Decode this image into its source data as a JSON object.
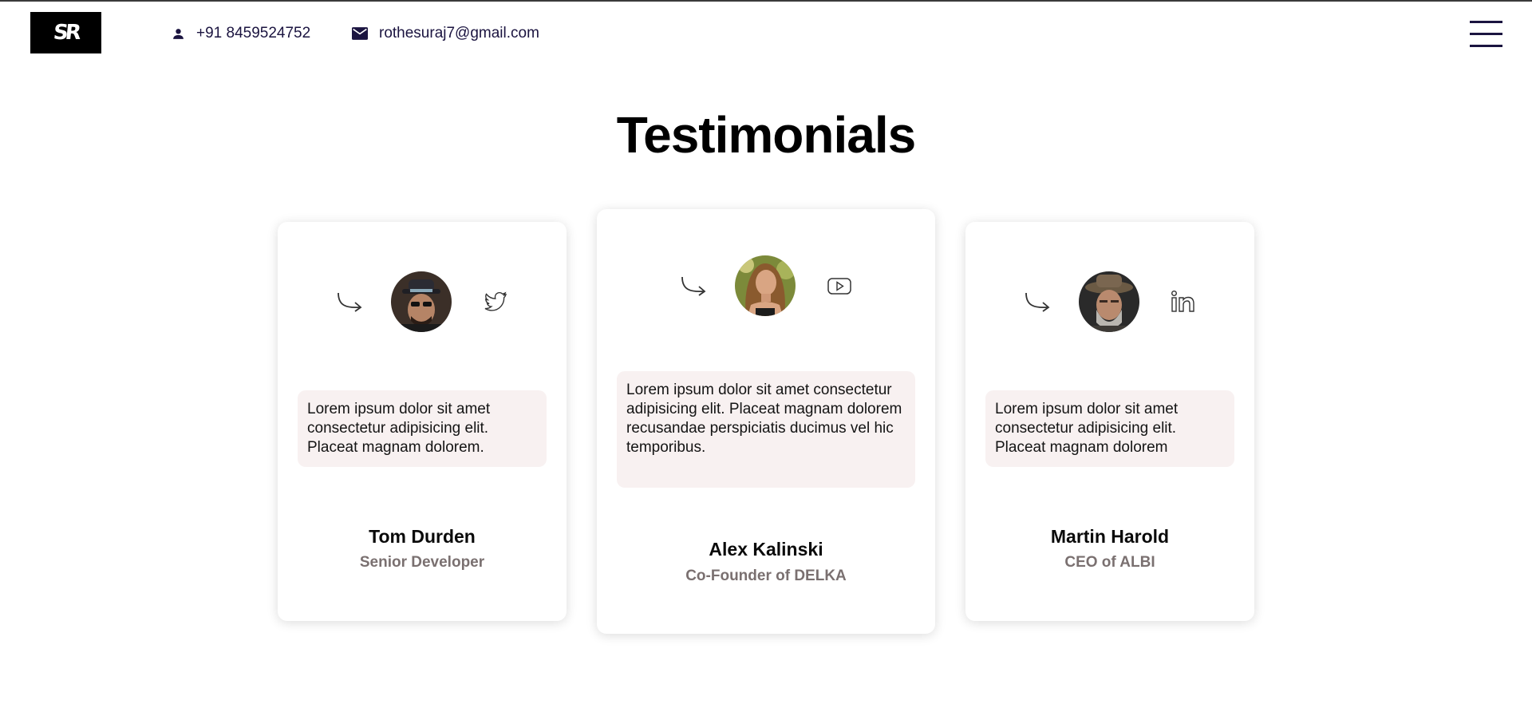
{
  "header": {
    "logo_text": "SR",
    "phone": "+91 8459524752",
    "email": "rothesuraj7@gmail.com",
    "phone_icon": "person-icon",
    "email_icon": "mail-icon",
    "menu_icon": "hamburger-menu-icon",
    "accent_color": "#1b1440"
  },
  "page": {
    "title": "Testimonials"
  },
  "testimonials": [
    {
      "name": "Tom Durden",
      "role": "Senior Developer",
      "quote": "Lorem ipsum dolor sit amet consectetur adipisicing elit. Placeat magnam dolorem.",
      "social_icon": "twitter-icon"
    },
    {
      "name": "Alex Kalinski",
      "role": "Co-Founder of DELKA",
      "quote": "Lorem ipsum dolor sit amet consectetur adipisicing elit. Placeat magnam dolorem recusandae perspiciatis ducimus vel hic temporibus.",
      "social_icon": "youtube-icon"
    },
    {
      "name": "Martin Harold",
      "role": "CEO of ALBI",
      "quote": "Lorem ipsum dolor sit amet consectetur adipisicing elit. Placeat magnam dolorem",
      "social_icon": "linkedin-icon"
    }
  ],
  "colors": {
    "quote_background": "#f8f1f1",
    "role_text": "#7a7070"
  }
}
